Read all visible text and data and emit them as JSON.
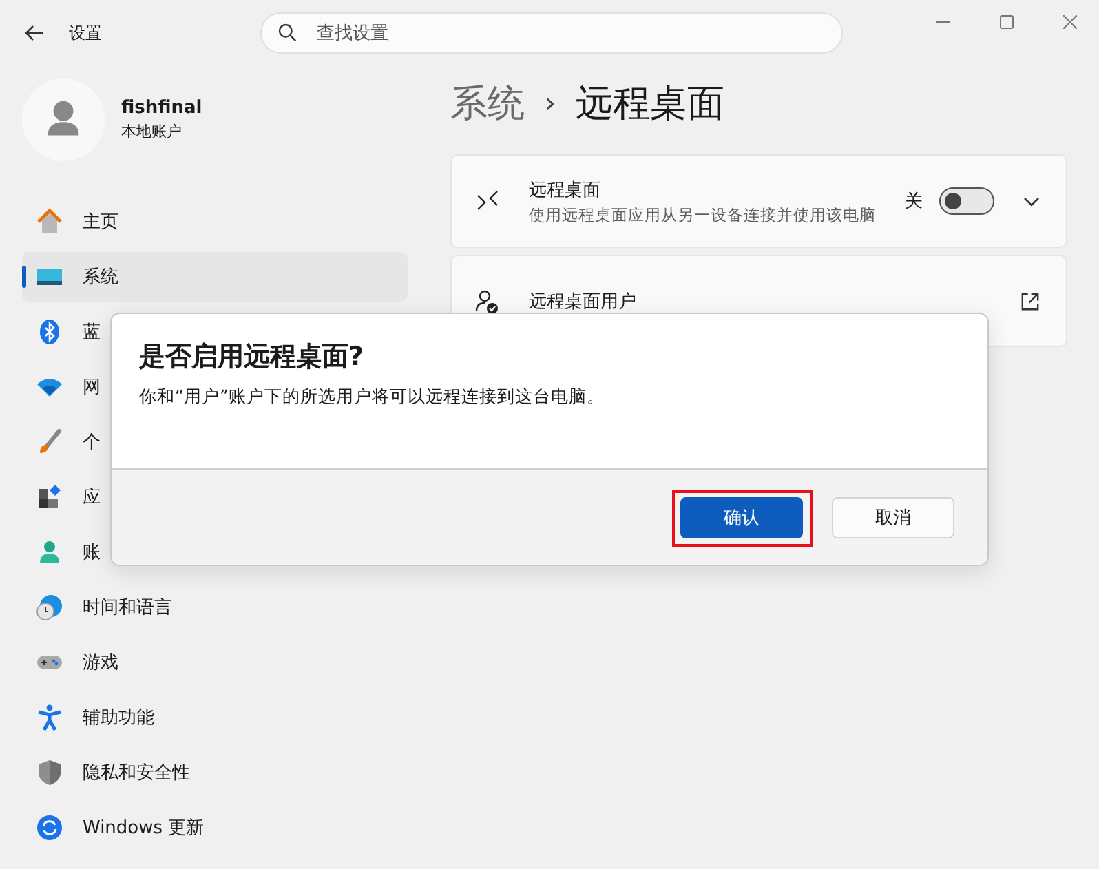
{
  "window": {
    "title": "设置"
  },
  "search": {
    "placeholder": "查找设置"
  },
  "account": {
    "name": "fishfinal",
    "type": "本地账户"
  },
  "sidebar": {
    "items": [
      {
        "label": "主页",
        "selected": false
      },
      {
        "label": "系统",
        "selected": true
      },
      {
        "label": "蓝",
        "selected": false
      },
      {
        "label": "网",
        "selected": false
      },
      {
        "label": "个",
        "selected": false
      },
      {
        "label": "应",
        "selected": false
      },
      {
        "label": "账",
        "selected": false
      },
      {
        "label": "时间和语言",
        "selected": false
      },
      {
        "label": "游戏",
        "selected": false
      },
      {
        "label": "辅助功能",
        "selected": false
      },
      {
        "label": "隐私和安全性",
        "selected": false
      },
      {
        "label": "Windows 更新",
        "selected": false
      }
    ]
  },
  "breadcrumb": {
    "parent": "系统",
    "separator": "›",
    "current": "远程桌面"
  },
  "settings": [
    {
      "kind": "toggle",
      "title": "远程桌面",
      "description": "使用远程桌面应用从另一设备连接并使用该电脑",
      "state_label": "关",
      "on": false,
      "expanded": false
    },
    {
      "kind": "link",
      "title": "远程桌面用户"
    }
  ],
  "dialog": {
    "title": "是否启用远程桌面?",
    "message": "你和“用户”账户下的所选用户将可以远程连接到这台电脑。",
    "buttons": [
      {
        "label": "确认",
        "primary": true,
        "highlighted": true
      },
      {
        "label": "取消",
        "primary": false,
        "highlighted": false
      }
    ]
  }
}
